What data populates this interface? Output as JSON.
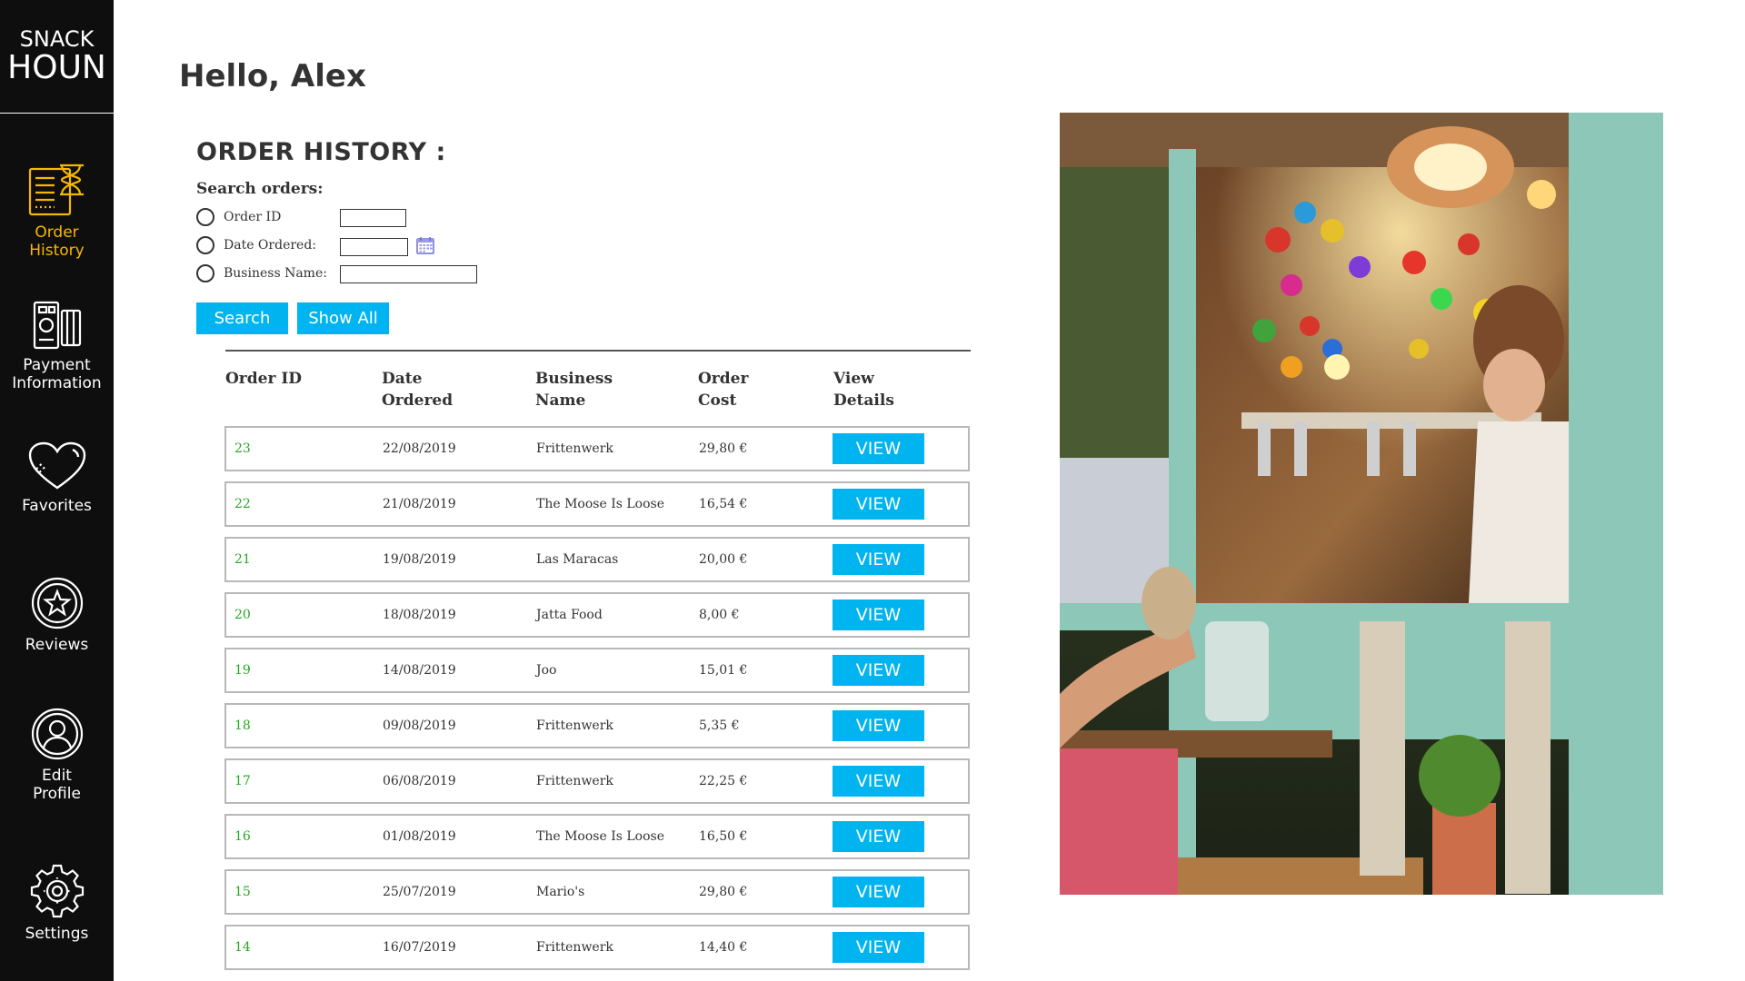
{
  "brand": {
    "line1": "SNACK",
    "line2": "HOUN"
  },
  "nav": [
    {
      "label": "Order\nHistory",
      "icon": "order-history-icon",
      "active": true
    },
    {
      "label": "Payment\nInformation",
      "icon": "payment-icon",
      "active": false
    },
    {
      "label": "Favorites",
      "icon": "heart-icon",
      "active": false
    },
    {
      "label": "Reviews",
      "icon": "star-icon",
      "active": false
    },
    {
      "label": "Edit\nProfile",
      "icon": "user-icon",
      "active": false
    },
    {
      "label": "Settings",
      "icon": "gear-icon",
      "active": false
    }
  ],
  "greeting": "Hello, Alex",
  "order_history": {
    "title": "ORDER HISTORY :",
    "search": {
      "heading": "Search orders:",
      "options": [
        {
          "label": "Order ID",
          "value": ""
        },
        {
          "label": "Date Ordered:",
          "value": ""
        },
        {
          "label": "Business Name:",
          "value": ""
        }
      ],
      "search_button": "Search",
      "show_all_button": "Show All"
    },
    "columns": [
      "Order ID",
      "Date\nOrdered",
      "Business\nName",
      "Order\nCost",
      "View\nDetails"
    ],
    "rows": [
      {
        "id": "23",
        "date": "22/08/2019",
        "business": "Frittenwerk",
        "cost": "29,80 €",
        "action": "VIEW"
      },
      {
        "id": "22",
        "date": "21/08/2019",
        "business": "The Moose Is Loose",
        "cost": "16,54 €",
        "action": "VIEW"
      },
      {
        "id": "21",
        "date": "19/08/2019",
        "business": "Las Maracas",
        "cost": "20,00 €",
        "action": "VIEW"
      },
      {
        "id": "20",
        "date": "18/08/2019",
        "business": "Jatta Food",
        "cost": "8,00 €",
        "action": "VIEW"
      },
      {
        "id": "19",
        "date": "14/08/2019",
        "business": "Joo",
        "cost": "15,01 €",
        "action": "VIEW"
      },
      {
        "id": "18",
        "date": "09/08/2019",
        "business": "Frittenwerk",
        "cost": "5,35 €",
        "action": "VIEW"
      },
      {
        "id": "17",
        "date": "06/08/2019",
        "business": "Frittenwerk",
        "cost": "22,25 €",
        "action": "VIEW"
      },
      {
        "id": "16",
        "date": "01/08/2019",
        "business": "The Moose Is Loose",
        "cost": "16,50 €",
        "action": "VIEW"
      },
      {
        "id": "15",
        "date": "25/07/2019",
        "business": "Mario's",
        "cost": "29,80 €",
        "action": "VIEW"
      },
      {
        "id": "14",
        "date": "16/07/2019",
        "business": "Frittenwerk",
        "cost": "14,40 €",
        "action": "VIEW"
      }
    ]
  },
  "colors": {
    "sidebar_bg": "#0e0e0e",
    "active_nav": "#f5b800",
    "accent_button": "#00b4f0",
    "order_id_text": "#22aa22"
  }
}
